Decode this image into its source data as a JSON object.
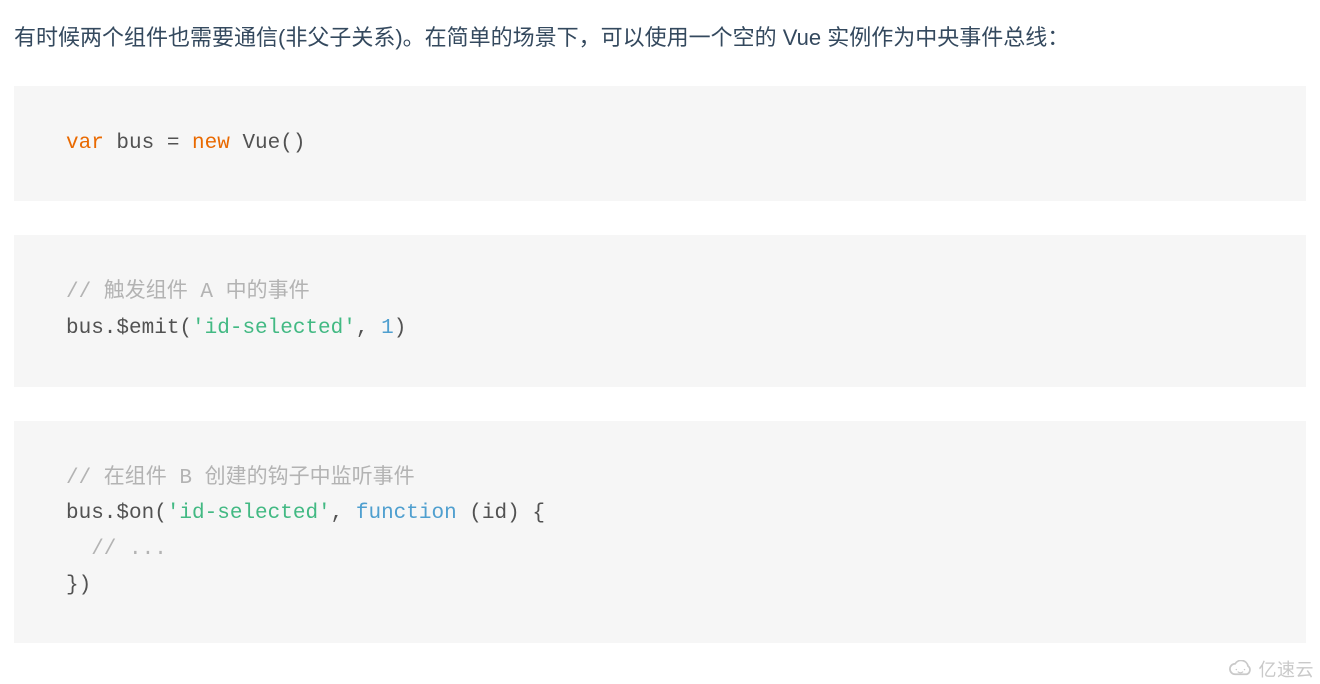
{
  "intro": "有时候两个组件也需要通信(非父子关系)。在简单的场景下，可以使用一个空的 Vue 实例作为中央事件总线：",
  "code1": {
    "kw_var": "var",
    "t1": " bus = ",
    "kw_new": "new",
    "t2": " Vue()"
  },
  "code2": {
    "comment": "// 触发组件 A 中的事件",
    "line2_a": "bus.$emit(",
    "line2_str": "'id-selected'",
    "line2_b": ", ",
    "line2_num": "1",
    "line2_c": ")"
  },
  "code3": {
    "comment": "// 在组件 B 创建的钩子中监听事件",
    "line2_a": "bus.$on(",
    "line2_str": "'id-selected'",
    "line2_b": ", ",
    "line2_func": "function",
    "line2_c": " (id) {",
    "line3": "  // ...",
    "line4": "})"
  },
  "watermark": "亿速云"
}
